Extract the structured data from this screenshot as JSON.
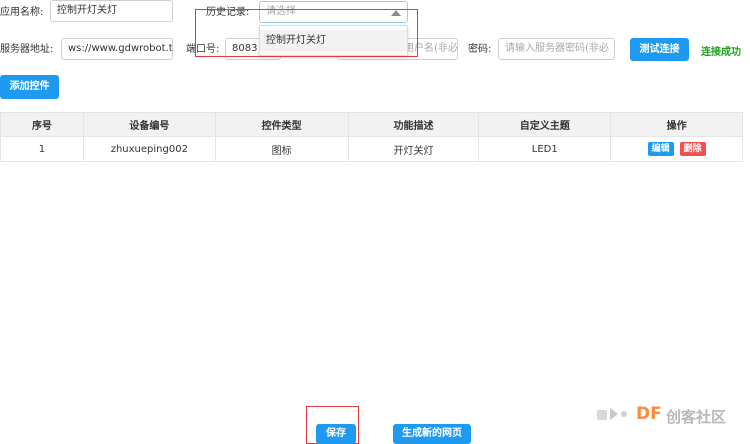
{
  "form": {
    "app_name_label": "应用名称:",
    "app_name_value": "控制开灯关灯",
    "history_label": "历史记录:",
    "history_placeholder": "请选择",
    "history_options": [
      "控制开灯关灯"
    ],
    "server_label": "服务器地址:",
    "server_value": "ws://www.gdwrobot.top",
    "port_label": "端口号:",
    "port_value": "8083",
    "username_placeholder": "请输入服务器用户名(非必",
    "password_label": "密码:",
    "password_placeholder": "请输入服务器密码(非必",
    "test_connect_button": "测试连接",
    "connect_status": "连接成功"
  },
  "toolbar": {
    "add_control_button": "添加控件"
  },
  "table": {
    "headers": [
      "序号",
      "设备编号",
      "控件类型",
      "功能描述",
      "自定义主题",
      "操作"
    ],
    "rows": [
      {
        "index": "1",
        "device_id": "zhuxueping002",
        "control_type": "图标",
        "description": "开灯关灯",
        "topic": "LED1",
        "edit": "编辑",
        "delete": "删除"
      }
    ]
  },
  "footer": {
    "save_button": "保存",
    "generate_button": "生成新的网页"
  },
  "watermark": {
    "logo": "DF",
    "text": "创客社区"
  },
  "colors": {
    "primary": "#1e9bf0",
    "danger": "#f05050",
    "success": "#20a020",
    "highlight": "#e0393e"
  }
}
